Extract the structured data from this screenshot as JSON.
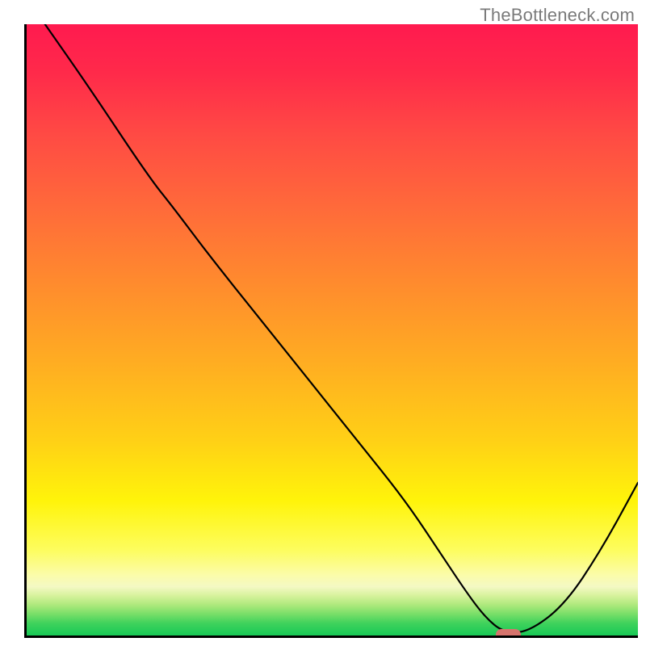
{
  "watermark": "TheBottleneck.com",
  "chart_data": {
    "type": "line",
    "title": "",
    "xlabel": "",
    "ylabel": "",
    "xlim": [
      0,
      100
    ],
    "ylim": [
      0,
      100
    ],
    "grid": false,
    "legend": false,
    "series": [
      {
        "name": "bottleneck-curve",
        "x": [
          3,
          10,
          20,
          24,
          30,
          38,
          46,
          54,
          62,
          68,
          72,
          75,
          78,
          82,
          88,
          94,
          100
        ],
        "values": [
          100,
          90,
          75,
          70,
          62,
          52,
          42,
          32,
          22,
          13,
          7,
          3,
          0.5,
          0.5,
          5,
          14,
          25
        ]
      }
    ],
    "marker": {
      "name": "optimal-point",
      "x_center": 78.5,
      "width_pct": 4,
      "y": 0.5,
      "color": "#d6746d"
    },
    "background_gradient": {
      "top": "#ff1a4f",
      "mid": "#ffd016",
      "bottom": "#17c956"
    }
  }
}
